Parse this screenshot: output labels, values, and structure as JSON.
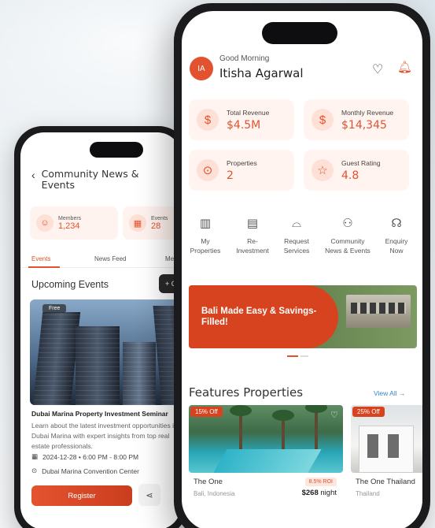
{
  "colors": {
    "accent": "#e2522e",
    "link": "#3a86c4"
  },
  "back_phone": {
    "header": {
      "title": "Community News & Events"
    },
    "stats": [
      {
        "label": "Members",
        "value": "1,234",
        "icon": "people-icon"
      },
      {
        "label": "Events",
        "value": "28",
        "icon": "calendar-icon"
      }
    ],
    "tabs": [
      "Events",
      "News Feed",
      "Me"
    ],
    "section_title": "Upcoming Events",
    "create_label": "+ C",
    "event": {
      "badge": "Free",
      "title": "Dubai Marina Property Investment Seminar",
      "description": "Learn about the latest investment opportunities in Dubai Marina with expert insights from top real estate professionals.",
      "datetime": "2024-12-28 • 6:00 PM - 8:00 PM",
      "location": "Dubai Marina Convention Center",
      "register_label": "Register"
    }
  },
  "front_phone": {
    "avatar_initials": "IA",
    "greeting": "Good Morning",
    "user_name": "Itisha Agarwal",
    "stats": [
      {
        "label": "Total Revenue",
        "value": "$4.5M",
        "icon": "dollar-icon"
      },
      {
        "label": "Monthly Revenue",
        "value": "$14,345",
        "icon": "dollar-icon"
      },
      {
        "label": "Properties",
        "value": "2",
        "icon": "location-pin-icon"
      },
      {
        "label": "Guest Rating",
        "value": "4.8",
        "icon": "star-icon"
      }
    ],
    "quick_actions": [
      {
        "line1": "My",
        "line2": "Properties",
        "icon": "building-icon"
      },
      {
        "line1": "Re-",
        "line2": "Investment",
        "icon": "chart-icon"
      },
      {
        "line1": "Request",
        "line2": "Services",
        "icon": "service-bell-icon"
      },
      {
        "line1": "Community",
        "line2": "News & Events",
        "icon": "community-icon"
      },
      {
        "line1": "Enquiry",
        "line2": "Now",
        "icon": "headset-icon"
      }
    ],
    "banner": {
      "line1": "Bali Made Easy & Savings-",
      "line2": "Filled!"
    },
    "featured_title": "Features Properties",
    "view_all": "View All →",
    "properties": [
      {
        "discount": "15% Off",
        "name": "The One",
        "location": "Bali, Indonesia",
        "roi": "8.5% ROI",
        "price": "$268",
        "unit": "night"
      },
      {
        "discount": "25% Off",
        "name": "The One Thailand",
        "location": "Thailand"
      }
    ]
  }
}
